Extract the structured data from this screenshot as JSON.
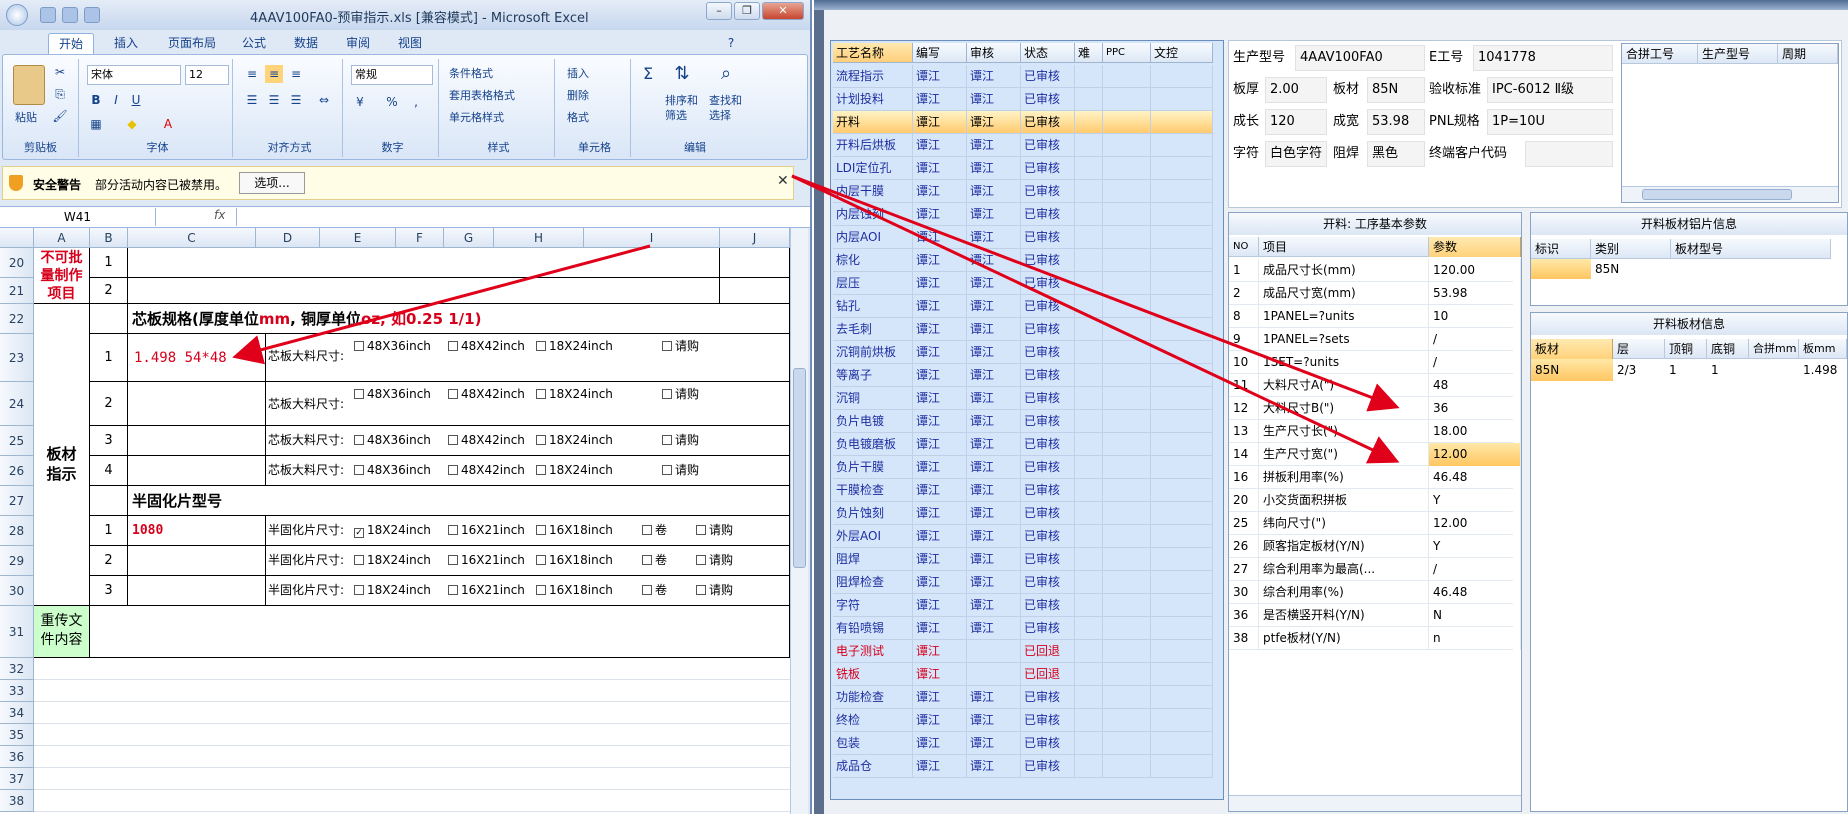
{
  "excel": {
    "title": "4AAV100FA0-预审指示.xls  [兼容模式] - Microsoft Excel",
    "tabs": [
      "开始",
      "插入",
      "页面布局",
      "公式",
      "数据",
      "审阅",
      "视图"
    ],
    "clipboard": {
      "paste": "粘贴",
      "label": "剪贴板"
    },
    "font": {
      "name": "宋体",
      "size": "12",
      "label": "字体"
    },
    "alignment": {
      "label": "对齐方式"
    },
    "number": {
      "format": "常规",
      "label": "数字"
    },
    "styles": {
      "cond": "条件格式",
      "table": "套用表格格式",
      "cell": "单元格样式",
      "label": "样式"
    },
    "cells": {
      "insert": "插入",
      "delete": "删除",
      "format": "格式",
      "label": "单元格"
    },
    "editing": {
      "sort": "排序和\n筛选",
      "find": "查找和\n选择",
      "label": "编辑"
    },
    "security": {
      "title": "安全警告",
      "text": "部分活动内容已被禁用。",
      "button": "选项..."
    },
    "namebox": "W41",
    "fx": "fx",
    "columns": [
      "A",
      "B",
      "C",
      "D",
      "E",
      "F",
      "G",
      "H",
      "I",
      "J"
    ],
    "rows": [
      "20",
      "21",
      "22",
      "23",
      "24",
      "25",
      "26",
      "27",
      "28",
      "29",
      "30",
      "31",
      "32",
      "33",
      "34",
      "35",
      "36",
      "37",
      "38"
    ],
    "sheet": {
      "noBatch": "不可批\n量制作\n项目",
      "n1": "1",
      "n2": "2",
      "n3": "3",
      "n4": "4",
      "coreTitle": "芯板规格(厚度单位",
      "coreTitleMm": "mm",
      "coreTitleMid": ", 铜厚单位",
      "coreTitleOz": "oz",
      "coreTitleEnd": ", 如0.25 1/1)",
      "coreValue": "1.498 54*48",
      "coreSizeLabel": "芯板大料尺寸:",
      "opt48x36": "48X36inch",
      "opt48x42": "48X42inch",
      "opt18x24": "18X24inch",
      "purchase": "请购",
      "boardGuide": "板材\n指示",
      "prepregTitle": "半固化片型号",
      "prepregValue": "1080",
      "prepregSizeLabel": "半固化片尺寸:",
      "opt18x24b": "18X24inch",
      "opt16x21": "16X21inch",
      "opt16x18": "16X18inch",
      "roll": "卷",
      "reupload": "重传文\n件内容"
    }
  },
  "app": {
    "processHeader": [
      "工艺名称",
      "编写",
      "审核",
      "状态",
      "难",
      "PPC",
      "文控"
    ],
    "processes": [
      {
        "name": "流程指示",
        "writer": "谭江",
        "reviewer": "谭江",
        "status": "已审核"
      },
      {
        "name": "计划投料",
        "writer": "谭江",
        "reviewer": "谭江",
        "status": "已审核"
      },
      {
        "name": "开料",
        "writer": "谭江",
        "reviewer": "谭江",
        "status": "已审核",
        "selected": true
      },
      {
        "name": "开料后烘板",
        "writer": "谭江",
        "reviewer": "谭江",
        "status": "已审核"
      },
      {
        "name": "LDI定位孔",
        "writer": "谭江",
        "reviewer": "谭江",
        "status": "已审核"
      },
      {
        "name": "内层干膜",
        "writer": "谭江",
        "reviewer": "谭江",
        "status": "已审核"
      },
      {
        "name": "内层蚀刻",
        "writer": "谭江",
        "reviewer": "谭江",
        "status": "已审核"
      },
      {
        "name": "内层AOI",
        "writer": "谭江",
        "reviewer": "谭江",
        "status": "已审核"
      },
      {
        "name": "棕化",
        "writer": "谭江",
        "reviewer": "谭江",
        "status": "已审核"
      },
      {
        "name": "层压",
        "writer": "谭江",
        "reviewer": "谭江",
        "status": "已审核"
      },
      {
        "name": "钻孔",
        "writer": "谭江",
        "reviewer": "谭江",
        "status": "已审核"
      },
      {
        "name": "去毛刺",
        "writer": "谭江",
        "reviewer": "谭江",
        "status": "已审核"
      },
      {
        "name": "沉铜前烘板",
        "writer": "谭江",
        "reviewer": "谭江",
        "status": "已审核"
      },
      {
        "name": "等离子",
        "writer": "谭江",
        "reviewer": "谭江",
        "status": "已审核"
      },
      {
        "name": "沉铜",
        "writer": "谭江",
        "reviewer": "谭江",
        "status": "已审核"
      },
      {
        "name": "负片电镀",
        "writer": "谭江",
        "reviewer": "谭江",
        "status": "已审核"
      },
      {
        "name": "负电镀磨板",
        "writer": "谭江",
        "reviewer": "谭江",
        "status": "已审核"
      },
      {
        "name": "负片干膜",
        "writer": "谭江",
        "reviewer": "谭江",
        "status": "已审核"
      },
      {
        "name": "干膜检查",
        "writer": "谭江",
        "reviewer": "谭江",
        "status": "已审核"
      },
      {
        "name": "负片蚀刻",
        "writer": "谭江",
        "reviewer": "谭江",
        "status": "已审核"
      },
      {
        "name": "外层AOI",
        "writer": "谭江",
        "reviewer": "谭江",
        "status": "已审核"
      },
      {
        "name": "阻焊",
        "writer": "谭江",
        "reviewer": "谭江",
        "status": "已审核"
      },
      {
        "name": "阻焊检查",
        "writer": "谭江",
        "reviewer": "谭江",
        "status": "已审核"
      },
      {
        "name": "字符",
        "writer": "谭江",
        "reviewer": "谭江",
        "status": "已审核"
      },
      {
        "name": "有铅喷锡",
        "writer": "谭江",
        "reviewer": "谭江",
        "status": "已审核"
      },
      {
        "name": "电子测试",
        "writer": "谭江",
        "reviewer": "",
        "status": "已回退",
        "back": true
      },
      {
        "name": "铣板",
        "writer": "谭江",
        "reviewer": "",
        "status": "已回退",
        "back": true
      },
      {
        "name": "功能检查",
        "writer": "谭江",
        "reviewer": "谭江",
        "status": "已审核"
      },
      {
        "name": "终检",
        "writer": "谭江",
        "reviewer": "谭江",
        "status": "已审核"
      },
      {
        "name": "包装",
        "writer": "谭江",
        "reviewer": "谭江",
        "status": "已审核"
      },
      {
        "name": "成品仓",
        "writer": "谭江",
        "reviewer": "谭江",
        "status": "已审核"
      }
    ],
    "info": {
      "modelLabel": "生产型号",
      "model": "4AAV100FA0",
      "eLabel": "E工号",
      "e": "1041778",
      "thickLabel": "板厚",
      "thick": "2.00",
      "matLabel": "板材",
      "mat": "85N",
      "stdLabel": "验收标准",
      "std": "IPC-6012 Ⅱ级",
      "lenLabel": "成长",
      "len": "120",
      "widLabel": "成宽",
      "wid": "53.98",
      "pnlLabel": "PNL规格",
      "pnl": "1P=10U",
      "charLabel": "字符",
      "char": "白色字符",
      "maskLabel": "阻焊",
      "mask": "黑色",
      "custLabel": "终端客户代码",
      "cust": ""
    },
    "mergeHeader": [
      "合拼工号",
      "生产型号",
      "周期"
    ],
    "paramTitle": "开料: 工序基本参数",
    "paramHeader": [
      "NO",
      "项目",
      "参数"
    ],
    "params": [
      {
        "no": "1",
        "item": "成品尺寸长(mm)",
        "val": "120.00"
      },
      {
        "no": "2",
        "item": "成品尺寸宽(mm)",
        "val": "53.98"
      },
      {
        "no": "8",
        "item": "1PANEL=?units",
        "val": "10"
      },
      {
        "no": "9",
        "item": "1PANEL=?sets",
        "val": "/"
      },
      {
        "no": "10",
        "item": "1SET=?units",
        "val": "/"
      },
      {
        "no": "11",
        "item": "大料尺寸A(\")",
        "val": "48"
      },
      {
        "no": "12",
        "item": "大料尺寸B(\")",
        "val": "36"
      },
      {
        "no": "13",
        "item": "生产尺寸长(\")",
        "val": "18.00"
      },
      {
        "no": "14",
        "item": "生产尺寸宽(\")",
        "val": "12.00",
        "hl": true
      },
      {
        "no": "16",
        "item": "拼板利用率(%)",
        "val": "46.48"
      },
      {
        "no": "20",
        "item": "小交货面积拼板",
        "val": "Y"
      },
      {
        "no": "25",
        "item": "纬向尺寸(\")",
        "val": "12.00"
      },
      {
        "no": "26",
        "item": "顾客指定板材(Y/N)",
        "val": "Y"
      },
      {
        "no": "27",
        "item": "综合利用率为最高(...",
        "val": "/"
      },
      {
        "no": "30",
        "item": "综合利用率(%)",
        "val": "46.48"
      },
      {
        "no": "36",
        "item": "是否横竖开料(Y/N)",
        "val": "N"
      },
      {
        "no": "38",
        "item": "ptfe板材(Y/N)",
        "val": "n"
      }
    ],
    "foilTitle": "开料板材铝片信息",
    "foilHeader": [
      "标识",
      "类别",
      "板材型号"
    ],
    "foilRow": {
      "id": "",
      "type": "85N",
      "model": ""
    },
    "sheetTitle": "开料板材信息",
    "sheetHeader": [
      "板材",
      "层",
      "顶铜",
      "底铜",
      "合拼mm",
      "板mm"
    ],
    "sheetRow": {
      "mat": "85N",
      "layer": "2/3",
      "top": "1",
      "bottom": "1",
      "merge": "",
      "board": "1.498"
    }
  }
}
